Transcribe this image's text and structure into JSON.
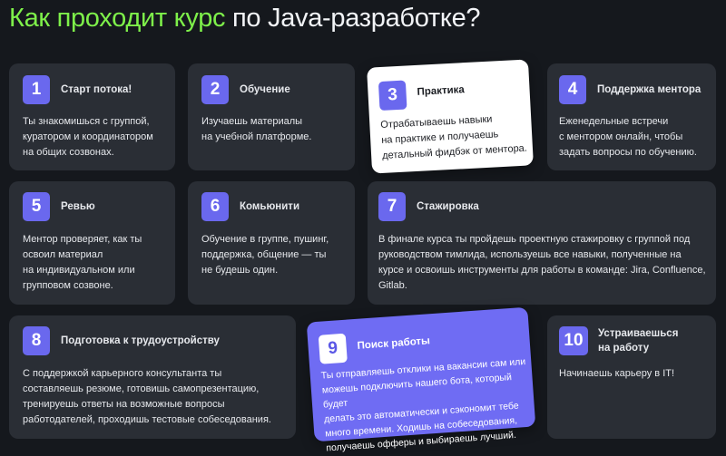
{
  "title": {
    "accent": "Как проходит курс",
    "rest": " по Java-разработке?"
  },
  "steps": [
    {
      "num": "1",
      "title": "Старт потока!",
      "text": "Ты знакомишься с группой,\nкуратором и координатором\nна общих созвонах."
    },
    {
      "num": "2",
      "title": "Обучение",
      "text": "Изучаешь материалы\nна учебной платформе."
    },
    {
      "num": "3",
      "title": "Практика",
      "text": "Отрабатываешь навыки\nна практике и получаешь\nдетальный фидбэк от ментора."
    },
    {
      "num": "4",
      "title": "Поддержка ментора",
      "text": "Еженедельные встречи\nс ментором онлайн, чтобы\nзадать вопросы по обучению."
    },
    {
      "num": "5",
      "title": "Ревью",
      "text": "Ментор проверяет, как ты\nосвоил материал\nна индивидуальном или\nгрупповом созвоне."
    },
    {
      "num": "6",
      "title": "Комьюнити",
      "text": "Обучение в группе, пушинг,\nподдержка, общение — ты\nне будешь один."
    },
    {
      "num": "7",
      "title": "Стажировка",
      "text": "В финале курса ты пройдешь проектную стажировку с группой под\nруководством тимлида, используешь все навыки, полученные на\nкурсе и освоишь инструменты для работы в команде: Jira, Confluence,\nGitlab."
    },
    {
      "num": "8",
      "title": "Подготовка к трудоустройству",
      "text": "С поддержкой карьерного консультанта ты\nсоставляешь резюме, готовишь самопрезентацию,\nтренируешь ответы на возможные вопросы\nработодателей, проходишь тестовые собеседования."
    },
    {
      "num": "9",
      "title": "Поиск работы",
      "text": "Ты отправляешь отклики на вакансии сам или\nможешь подключить нашего бота, который будет\nделать это автоматически и сэкономит тебе\nмного времени. Ходишь на собеседования,\nполучаешь офферы и выбираешь лучший."
    },
    {
      "num": "10",
      "title": "Устраиваешься\nна работу",
      "text": "Начинаешь карьеру в IT!"
    }
  ],
  "colors": {
    "background": "#15181d",
    "card": "#2a2e35",
    "accent_green": "#7ef04a",
    "number_badge": "#6a68ee",
    "highlight_violet": "#6f6cf3",
    "highlight_white": "#ffffff"
  }
}
